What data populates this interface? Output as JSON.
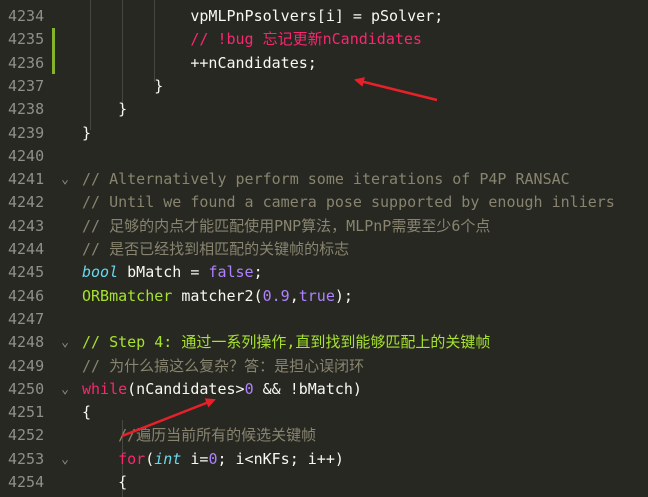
{
  "editor": {
    "lines": [
      {
        "num": "4234",
        "fold": "",
        "tokens": [
          {
            "t": "            vpMLPnPsolvers[i] = pSolver;",
            "c": "t-plain"
          }
        ]
      },
      {
        "num": "4235",
        "fold": "",
        "tokens": [
          {
            "t": "            // !bug 忘记更新nCandidates",
            "c": "t-red"
          }
        ]
      },
      {
        "num": "4236",
        "fold": "",
        "tokens": [
          {
            "t": "            ++nCandidates;",
            "c": "t-plain"
          }
        ]
      },
      {
        "num": "4237",
        "fold": "",
        "tokens": [
          {
            "t": "        }",
            "c": "t-plain"
          }
        ]
      },
      {
        "num": "4238",
        "fold": "",
        "tokens": [
          {
            "t": "    }",
            "c": "t-plain"
          }
        ]
      },
      {
        "num": "4239",
        "fold": "",
        "tokens": [
          {
            "t": "}",
            "c": "t-plain"
          }
        ]
      },
      {
        "num": "4240",
        "fold": "",
        "tokens": [
          {
            "t": "",
            "c": "t-plain"
          }
        ]
      },
      {
        "num": "4241",
        "fold": "⌄",
        "tokens": [
          {
            "t": "// Alternatively perform some iterations of P4P RANSAC",
            "c": "t-cmt"
          }
        ]
      },
      {
        "num": "4242",
        "fold": "",
        "tokens": [
          {
            "t": "// Until we found a camera pose supported by enough inliers",
            "c": "t-cmt"
          }
        ]
      },
      {
        "num": "4243",
        "fold": "",
        "tokens": [
          {
            "t": "// 足够的内点才能匹配使用PNP算法，MLPnP需要至少6个点",
            "c": "t-cmt"
          }
        ]
      },
      {
        "num": "4244",
        "fold": "",
        "tokens": [
          {
            "t": "// 是否已经找到相匹配的关键帧的标志",
            "c": "t-cmt"
          }
        ]
      },
      {
        "num": "4245",
        "fold": "",
        "tokens": [
          {
            "t": "bool",
            "c": "t-type"
          },
          {
            "t": " bMatch = ",
            "c": "t-plain"
          },
          {
            "t": "false",
            "c": "t-num"
          },
          {
            "t": ";",
            "c": "t-plain"
          }
        ]
      },
      {
        "num": "4246",
        "fold": "",
        "tokens": [
          {
            "t": "ORBmatcher",
            "c": "t-fn"
          },
          {
            "t": " matcher2(",
            "c": "t-plain"
          },
          {
            "t": "0.9",
            "c": "t-num"
          },
          {
            "t": ",",
            "c": "t-plain"
          },
          {
            "t": "true",
            "c": "t-num"
          },
          {
            "t": ");",
            "c": "t-plain"
          }
        ]
      },
      {
        "num": "4247",
        "fold": "",
        "tokens": [
          {
            "t": "",
            "c": "t-plain"
          }
        ]
      },
      {
        "num": "4248",
        "fold": "⌄",
        "tokens": [
          {
            "t": "// Step 4: 通过一系列操作,直到找到能够匹配上的关键帧",
            "c": "t-step"
          }
        ]
      },
      {
        "num": "4249",
        "fold": "",
        "tokens": [
          {
            "t": "// 为什么搞这么复杂？答：是担心误闭环",
            "c": "t-cmt"
          }
        ]
      },
      {
        "num": "4250",
        "fold": "⌄",
        "tokens": [
          {
            "t": "while",
            "c": "t-kw"
          },
          {
            "t": "(nCandidates>",
            "c": "t-plain"
          },
          {
            "t": "0",
            "c": "t-num"
          },
          {
            "t": " && !bMatch)",
            "c": "t-plain"
          }
        ]
      },
      {
        "num": "4251",
        "fold": "",
        "tokens": [
          {
            "t": "{",
            "c": "t-plain"
          }
        ]
      },
      {
        "num": "4252",
        "fold": "",
        "tokens": [
          {
            "t": "    //遍历当前所有的候选关键帧",
            "c": "t-cmt"
          }
        ]
      },
      {
        "num": "4253",
        "fold": "⌄",
        "tokens": [
          {
            "t": "    ",
            "c": "t-plain"
          },
          {
            "t": "for",
            "c": "t-kw"
          },
          {
            "t": "(",
            "c": "t-plain"
          },
          {
            "t": "int",
            "c": "t-type"
          },
          {
            "t": " i=",
            "c": "t-plain"
          },
          {
            "t": "0",
            "c": "t-num"
          },
          {
            "t": "; i<nKFs; i++)",
            "c": "t-plain"
          }
        ]
      },
      {
        "num": "4254",
        "fold": "",
        "tokens": [
          {
            "t": "    {",
            "c": "t-plain"
          }
        ]
      }
    ]
  },
  "colors": {
    "background": "#272822",
    "comment": "#88846f",
    "keyword": "#f92672",
    "arrow": "#e8202a"
  },
  "icons": {
    "fold": "chevron-down-icon"
  }
}
